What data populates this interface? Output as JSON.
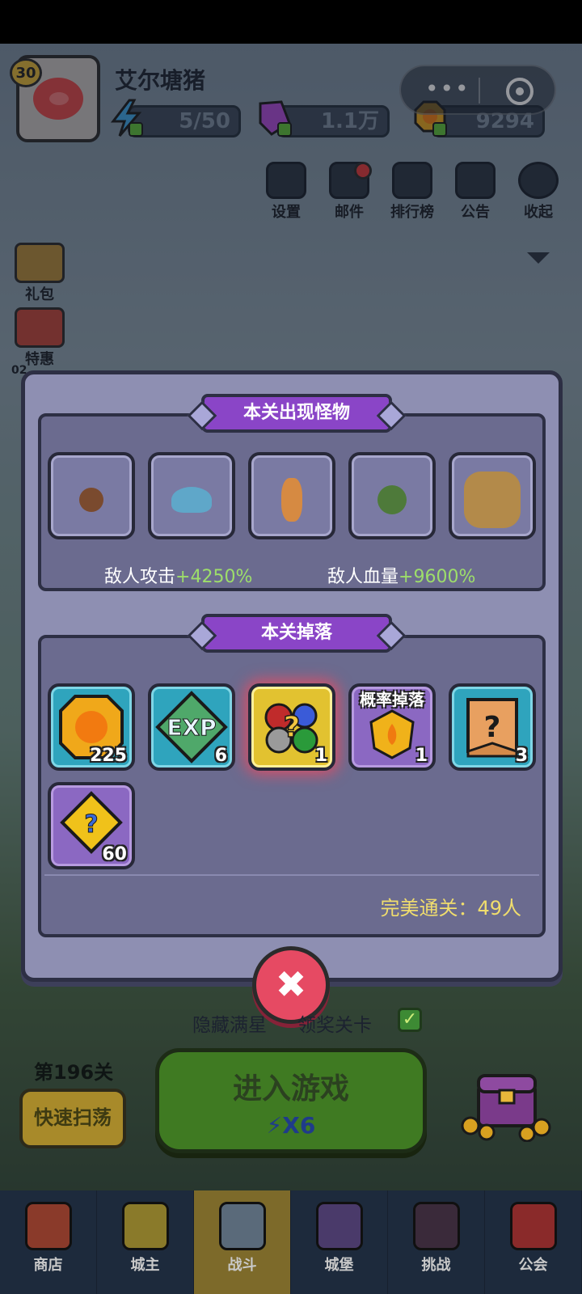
{
  "player": {
    "name": "艾尔塘猪",
    "level": "30"
  },
  "resources": {
    "energy": "5/50",
    "gems": "1.1万",
    "coins": "9294"
  },
  "top_menu": [
    "设置",
    "邮件",
    "排行榜",
    "公告",
    "收起"
  ],
  "side_menu": [
    "礼包",
    "特惠"
  ],
  "side_timer": "02",
  "panel": {
    "monsters_title": "本关出现怪物",
    "attack_label": "敌人攻击",
    "attack_value": "+4250%",
    "hp_label": "敌人血量",
    "hp_value": "+9600%",
    "drops_title": "本关掉落",
    "drops": [
      {
        "name": "coin-icon",
        "count": "225"
      },
      {
        "name": "exp-icon",
        "count": "6"
      },
      {
        "name": "gem-mystery-icon",
        "count": "1"
      },
      {
        "name": "fire-emblem-icon",
        "count": "1",
        "tag": "概率掉落"
      },
      {
        "name": "mystery-scroll-icon",
        "count": "3"
      },
      {
        "name": "puzzle-piece-icon",
        "count": "60"
      }
    ],
    "perfect_clear": "完美通关：49人"
  },
  "hidden_stage_text": "隐藏满星",
  "hidden_stage_suffix": "领奖关卡",
  "stage": "第196关",
  "sweep_button": "快速扫荡",
  "enter_button": "进入游戏",
  "enter_cost": "X6",
  "nav": [
    "商店",
    "城主",
    "战斗",
    "城堡",
    "挑战",
    "公会"
  ]
}
